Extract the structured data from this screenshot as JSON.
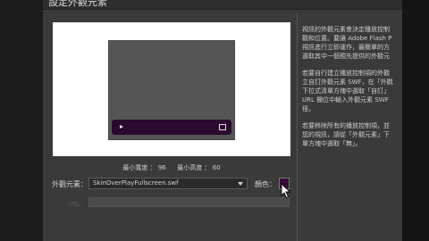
{
  "dialog": {
    "title": "設定外觀元素"
  },
  "preview": {
    "min_width_label": "最小寬度",
    "min_width_value": "96",
    "min_height_label": "最小高度",
    "min_height_value": "60"
  },
  "skin": {
    "label": "外觀元素：",
    "selected_value": "SkinOverPlayFullscreen.swf",
    "color_label": "顏色：",
    "color_value": "#3a0a3a",
    "url_label": "URL："
  },
  "help": {
    "paragraphs": [
      "視訊的外觀元素會決定播放控制",
      "觀和位置。要讓 Adobe Flash P",
      "視訊進行立即運作，最簡單的方",
      "選取其中一個預先提供的外觀元",
      "",
      "若要自行建立播放控制項的外觀",
      "立自訂外觀元素 SWF，在「外觀",
      "下拉式清單方塊中選取「自訂」",
      "URL 欄位中輸入外觀元素 SWF",
      "徑。",
      "",
      "若要移除所有的播放控制項，並",
      "您的視訊，請從「外觀元素」下",
      "單方塊中選取「無」。"
    ]
  }
}
